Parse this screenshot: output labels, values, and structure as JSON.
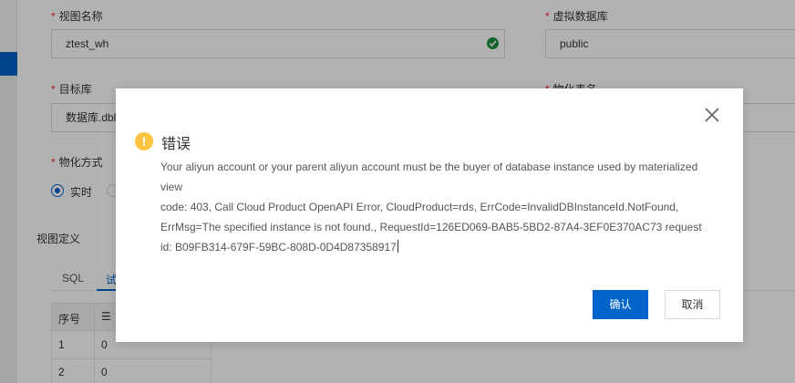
{
  "form": {
    "view_name_label": "视图名称",
    "view_name_value": "ztest_wh",
    "virtual_db_label": "虚拟数据库",
    "virtual_db_value": "public",
    "target_db_label": "目标库",
    "target_db_value": "数据库.dbl",
    "materialized_table_label": "物化表名",
    "materialize_mode_label": "物化方式",
    "materialize_mode_option": "实时"
  },
  "view_definition": {
    "title": "视图定义",
    "tabs": [
      "SQL",
      "试"
    ],
    "table": {
      "headers": [
        "序号",
        "☰"
      ],
      "rows": [
        [
          "1",
          "0"
        ],
        [
          "2",
          "0"
        ]
      ]
    }
  },
  "dialog": {
    "title": "错误",
    "message_lines": [
      "Your aliyun account or your parent aliyun account must be the buyer of database instance used by materialized view",
      "code: 403, Call Cloud Product OpenAPI Error, CloudProduct=rds, ErrCode=InvalidDBInstanceId.NotFound, ErrMsg=The specified instance is not found., RequestId=126ED069-BAB5-5BD2-87A4-3EF0E370AC73 request id: B09FB314-679F-59BC-808D-0D4D87358917"
    ],
    "confirm_label": "确认",
    "cancel_label": "取消"
  },
  "colors": {
    "primary": "#0064c8",
    "warning": "#ffc440",
    "success": "#1e8e3e",
    "required": "#f5222d"
  }
}
